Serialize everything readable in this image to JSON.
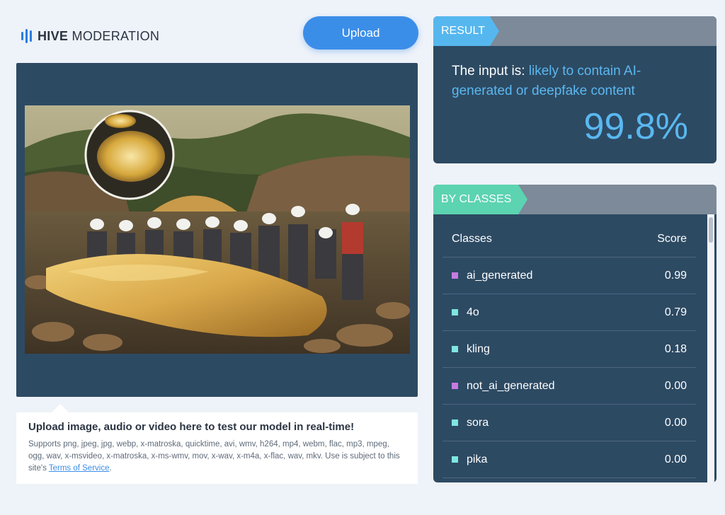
{
  "header": {
    "logo_bold": "HIVE",
    "logo_rest": "MODERATION",
    "upload_label": "Upload"
  },
  "info": {
    "title": "Upload image, audio or video here to test our model in real-time!",
    "supports_text": "Supports png, jpeg, jpg, webp, x-matroska, quicktime, avi, wmv, h264, mp4, webm, flac, mp3, mpeg, ogg, wav, x-msvideo, x-matroska, x-ms-wmv, mov, x-wav, x-m4a, x-flac, wav, mkv. Use is subject to this site's",
    "terms_link": "Terms of Service",
    "terms_suffix": "."
  },
  "result": {
    "tag": "RESULT",
    "prefix": "The input is:",
    "verdict": "likely to contain AI-generated or deepfake content",
    "percentage": "99.8%"
  },
  "classes": {
    "tag": "BY CLASSES",
    "col_class": "Classes",
    "col_score": "Score",
    "rows": [
      {
        "name": "ai_generated",
        "score": "0.99",
        "color": "#c67be0"
      },
      {
        "name": "4o",
        "score": "0.79",
        "color": "#7fe6e0"
      },
      {
        "name": "kling",
        "score": "0.18",
        "color": "#7fe6e0"
      },
      {
        "name": "not_ai_generated",
        "score": "0.00",
        "color": "#c67be0"
      },
      {
        "name": "sora",
        "score": "0.00",
        "color": "#7fe6e0"
      },
      {
        "name": "pika",
        "score": "0.00",
        "color": "#7fe6e0"
      }
    ]
  },
  "colors": {
    "accent_blue": "#3b8ee8",
    "panel": "#2d4a63",
    "result_tag": "#56b7ee",
    "classes_tag": "#5cd3b1"
  }
}
